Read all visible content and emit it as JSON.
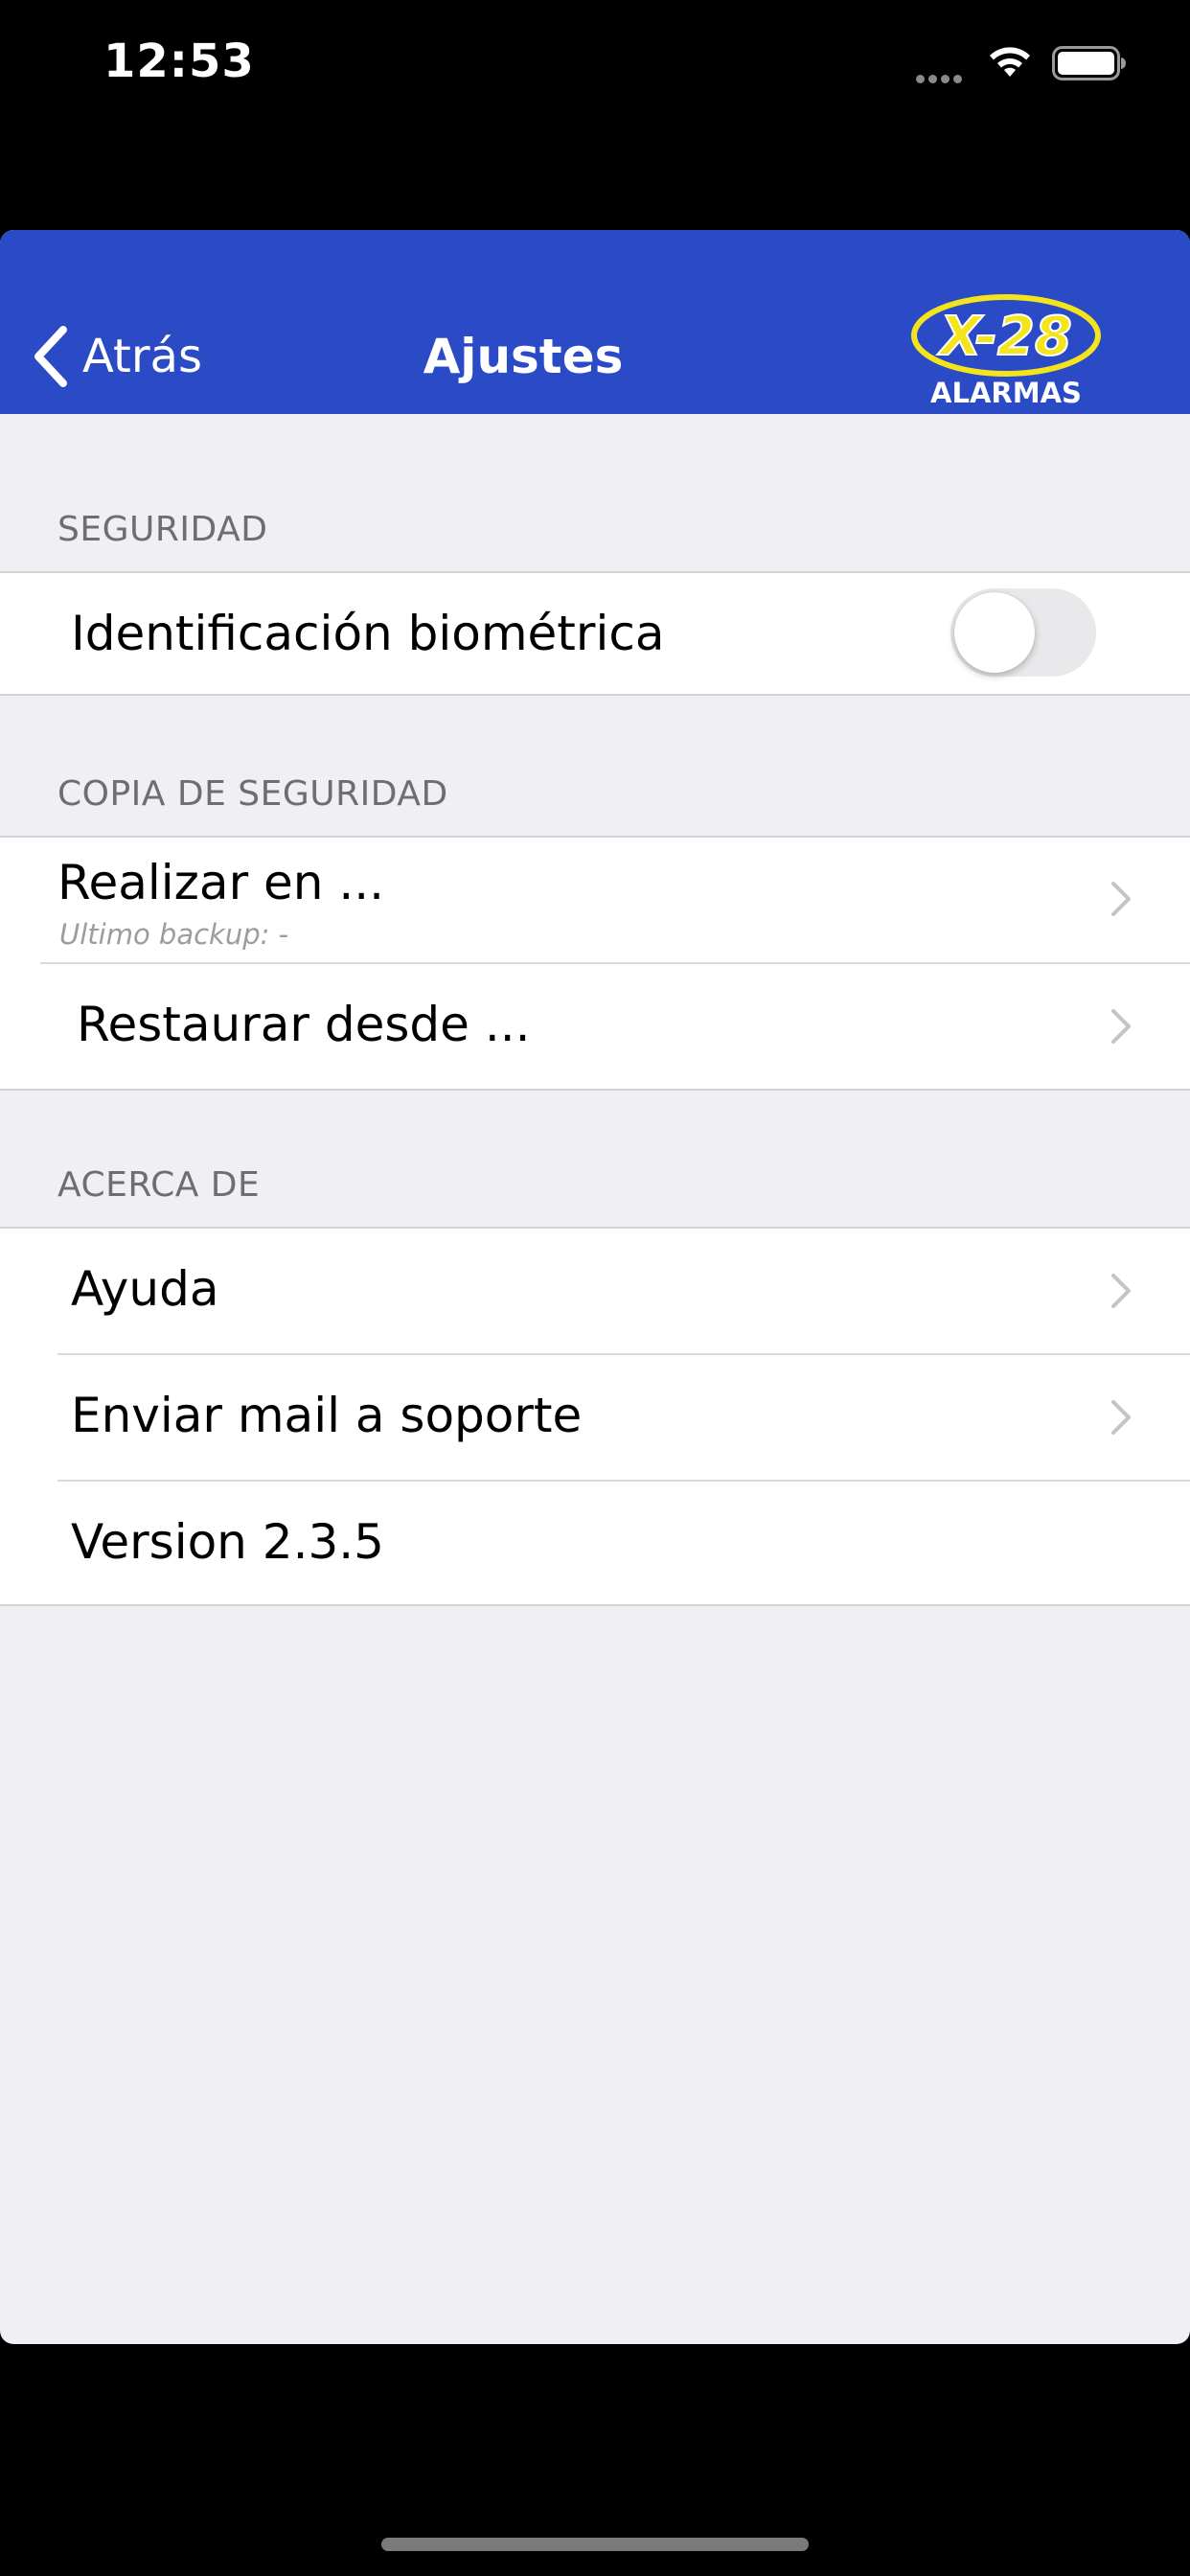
{
  "status_bar": {
    "time": "12:53"
  },
  "nav": {
    "back_label": "Atrás",
    "title": "Ajustes",
    "logo_text": "X-28",
    "logo_subtitle": "ALARMAS",
    "bar_color": "#2b4ac6",
    "logo_color": "#f4e41c"
  },
  "sections": {
    "security": {
      "header": "SEGURIDAD",
      "biometric_label": "Identificación biométrica",
      "biometric_enabled": false
    },
    "backup": {
      "header": "COPIA DE SEGURIDAD",
      "backup_label": "Realizar en ...",
      "backup_sub": "Ultimo backup: -",
      "restore_label": "Restaurar desde ..."
    },
    "about": {
      "header": "ACERCA DE",
      "help_label": "Ayuda",
      "support_label": "Enviar mail a soporte",
      "version_label": "Version 2.3.5"
    }
  },
  "icons": [
    "chevron-left-icon",
    "chevron-right-icon",
    "wifi-icon",
    "battery-icon",
    "signal-dots-icon",
    "x28-logo"
  ]
}
